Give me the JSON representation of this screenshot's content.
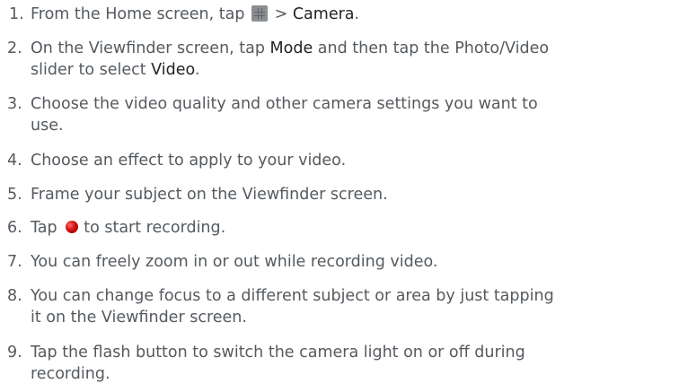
{
  "steps": [
    {
      "number": "1.",
      "before": "From the Home screen, tap",
      "icon": "apps-grid-icon",
      "middle": "> ",
      "emphasis": "Camera",
      "after": "."
    },
    {
      "number": "2.",
      "lines": [
        [
          "On the Viewfinder screen, tap ",
          "Mode",
          " and then tap the Photo/Video"
        ],
        [
          "slider to select ",
          "Video",
          "."
        ]
      ]
    },
    {
      "number": "3.",
      "lines": [
        "Choose the video quality and other camera settings you want to",
        "use."
      ]
    },
    {
      "number": "4.",
      "text": "Choose an effect to apply to your video."
    },
    {
      "number": "5.",
      "text": "Frame your subject on the Viewfinder screen."
    },
    {
      "number": "6.",
      "before": "Tap",
      "icon": "record-button-icon",
      "after": "to start recording."
    },
    {
      "number": "7.",
      "text": "You can freely zoom in or out while recording video."
    },
    {
      "number": "8.",
      "lines": [
        "You can change focus to a different subject or area by just tapping",
        "it on the Viewfinder screen."
      ]
    },
    {
      "number": "9.",
      "lines": [
        "Tap the flash button to switch the camera light on or off during",
        "recording."
      ]
    }
  ],
  "colors": {
    "text": "#555a5f",
    "emphasis": "#222222",
    "record": "#d10f0f"
  }
}
